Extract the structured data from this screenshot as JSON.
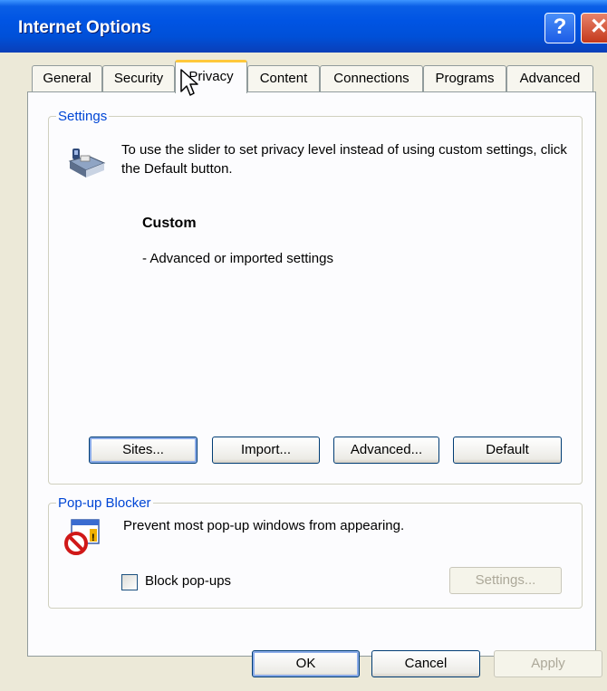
{
  "window": {
    "title": "Internet Options",
    "help_glyph": "?",
    "close_glyph": "✕"
  },
  "tabs": [
    {
      "label": "General"
    },
    {
      "label": "Security"
    },
    {
      "label": "Privacy",
      "active": true
    },
    {
      "label": "Content"
    },
    {
      "label": "Connections"
    },
    {
      "label": "Programs"
    },
    {
      "label": "Advanced"
    }
  ],
  "settings": {
    "legend": "Settings",
    "info_text": "To use the slider to set privacy level instead of using custom settings, click the Default button.",
    "level_title": "Custom",
    "level_desc": "- Advanced or imported settings",
    "buttons": {
      "sites": "Sites...",
      "import": "Import...",
      "advanced": "Advanced...",
      "default": "Default"
    }
  },
  "popup_blocker": {
    "legend": "Pop-up Blocker",
    "text": "Prevent most pop-up windows from appearing.",
    "checkbox_label": "Block pop-ups",
    "checked": false,
    "settings_button": "Settings..."
  },
  "footer": {
    "ok": "OK",
    "cancel": "Cancel",
    "apply": "Apply"
  }
}
